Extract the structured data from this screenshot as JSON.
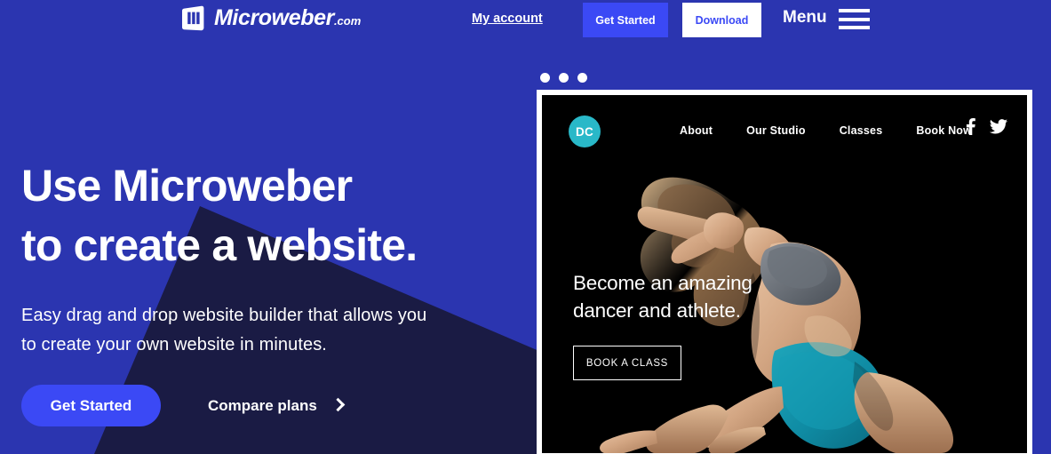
{
  "colors": {
    "page_bg": "#2B35B0",
    "accent_blue": "#3B49F5",
    "dark_navy": "#1A1B44",
    "white": "#FFFFFF",
    "teal": "#29B8C8",
    "preview_bg": "#000000"
  },
  "topnav": {
    "logo_text": "Microweber",
    "logo_suffix": ".com",
    "my_account": "My account",
    "get_started": "Get Started",
    "download": "Download",
    "menu": "Menu"
  },
  "hero": {
    "title_line1": "Use Microweber",
    "title_line2": "to create a website.",
    "subtitle_line1": "Easy drag and drop website builder that allows you",
    "subtitle_line2": "to create your own website in minutes.",
    "primary_cta": "Get Started",
    "secondary_cta": "Compare plans"
  },
  "preview": {
    "site_logo": "DC",
    "nav": [
      {
        "label": "About"
      },
      {
        "label": "Our Studio"
      },
      {
        "label": "Classes"
      },
      {
        "label": "Book Now"
      }
    ],
    "headline_line1": "Become an amazing",
    "headline_line2": "dancer and athlete.",
    "cta": "BOOK A CLASS"
  }
}
